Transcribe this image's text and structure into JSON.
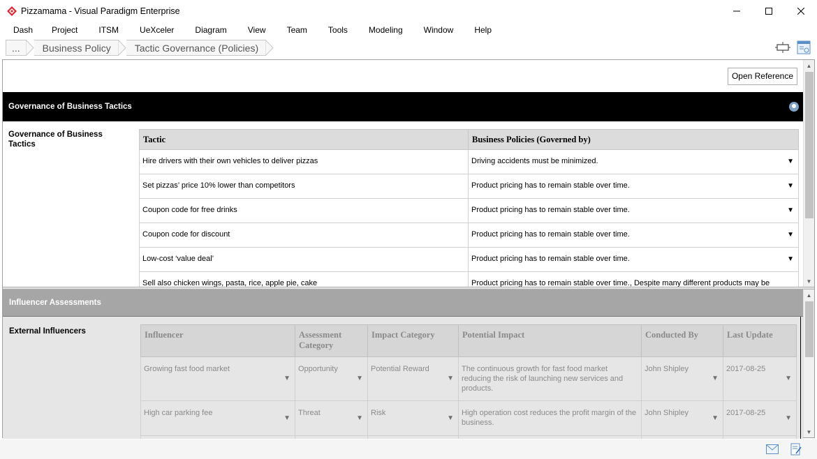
{
  "window": {
    "title": "Pizzamama - Visual Paradigm Enterprise",
    "minimize": "—",
    "maximize": "☐",
    "close": "✕"
  },
  "menu": [
    "Dash",
    "Project",
    "ITSM",
    "UeXceler",
    "Diagram",
    "View",
    "Team",
    "Tools",
    "Modeling",
    "Window",
    "Help"
  ],
  "breadcrumb": {
    "root": "...",
    "items": [
      "Business Policy",
      "Tactic Governance (Policies)"
    ]
  },
  "top": {
    "open_reference": "Open Reference",
    "section_title": "Governance of Business Tactics",
    "side_label": "Governance of Business Tactics",
    "columns": [
      "Tactic",
      "Business Policies (Governed by)"
    ],
    "rows": [
      {
        "tactic": "Hire drivers with their own vehicles to deliver pizzas",
        "policy": "Driving accidents must be minimized."
      },
      {
        "tactic": "Set pizzas’ price 10% lower than competitors",
        "policy": "Product pricing has to remain stable over time."
      },
      {
        "tactic": "Coupon code for free drinks",
        "policy": "Product pricing has to remain stable over time."
      },
      {
        "tactic": "Coupon code for discount",
        "policy": "Product pricing has to remain stable over time."
      },
      {
        "tactic": "Low-cost ‘value deal’",
        "policy": "Product pricing has to remain stable over time."
      },
      {
        "tactic": "Sell also chicken wings, pasta, rice, apple pie, cake",
        "policy": "Product pricing has to remain stable over time., Despite many different products may be"
      }
    ],
    "dropdown_glyph": "▼"
  },
  "bottom": {
    "section_title": "Influencer Assessments",
    "side_label": "External Influencers",
    "columns": [
      "Influencer",
      "Assessment Category",
      "Impact Category",
      "Potential Impact",
      "Conducted By",
      "Last Update"
    ],
    "rows": [
      {
        "influencer": "Growing fast food market",
        "assessment": "Opportunity",
        "impact": "Potential Reward",
        "potential": "The continuous growth for fast food market reducing the risk of launching new services and products.",
        "conducted": "John Shipley",
        "updated": "2017-08-25"
      },
      {
        "influencer": "High car parking fee",
        "assessment": "Threat",
        "impact": "Risk",
        "potential": "High operation cost reduces the profit margin of the business.",
        "conducted": "John Shipley",
        "updated": "2017-08-25"
      }
    ],
    "dropdown_glyph": "▼"
  },
  "scrollbar": {
    "up": "▲",
    "down": "▼"
  },
  "colors": {
    "accent": "#d9262f",
    "header_black": "#000000",
    "header_gray": "#a6a6a6",
    "table_header": "#dcdcdc"
  }
}
